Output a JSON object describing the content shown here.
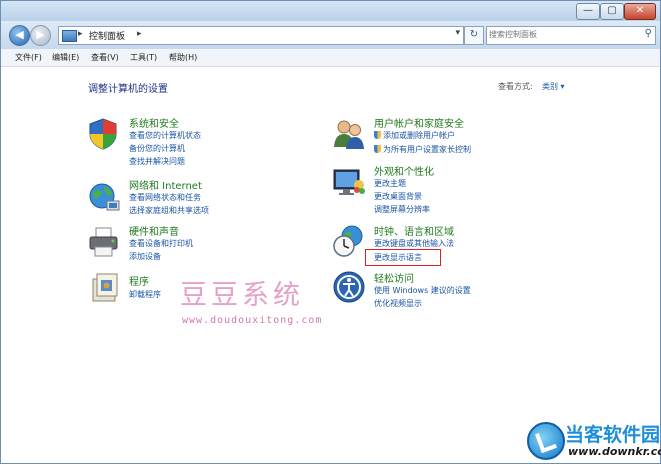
{
  "window": {
    "controls": [
      "—",
      "▢",
      "✕"
    ]
  },
  "address": {
    "path": "控制面板",
    "sep1": "▸",
    "sep2": "▸",
    "dropdown": "▾"
  },
  "refresh": "↻",
  "search": {
    "placeholder": "搜索控制面板"
  },
  "menubar": [
    "文件(F)",
    "编辑(E)",
    "查看(V)",
    "工具(T)",
    "帮助(H)"
  ],
  "main": {
    "title": "调整计算机的设置",
    "view_by_label": "查看方式:",
    "view_by_value": "类别 ▾"
  },
  "left_categories": [
    {
      "title": "系统和安全",
      "links": [
        "查看您的计算机状态",
        "备份您的计算机",
        "查找并解决问题"
      ]
    },
    {
      "title": "网络和 Internet",
      "links": [
        "查看网络状态和任务",
        "选择家庭组和共享选项"
      ]
    },
    {
      "title": "硬件和声音",
      "links": [
        "查看设备和打印机",
        "添加设备"
      ]
    },
    {
      "title": "程序",
      "links": [
        "卸载程序"
      ]
    }
  ],
  "right_categories": [
    {
      "title": "用户帐户和家庭安全",
      "links": [
        "添加或删除用户帐户",
        "为所有用户设置家长控制"
      ]
    },
    {
      "title": "外观和个性化",
      "links": [
        "更改主题",
        "更改桌面背景",
        "调整屏幕分辨率"
      ]
    },
    {
      "title": "时钟、语言和区域",
      "links": [
        "更改键盘或其他输入法",
        "更改显示语言"
      ]
    },
    {
      "title": "轻松访问",
      "links": [
        "使用 Windows 建议的设置",
        "优化视频显示"
      ]
    }
  ],
  "watermark": {
    "text": "豆豆系统",
    "url": "www.doudouxitong.com"
  },
  "brand": {
    "name": "当客软件园",
    "url": "www.downkr.com"
  },
  "colors": {
    "category_title": "#217a1e",
    "link": "#1a55a4",
    "highlight": "#e02020"
  }
}
